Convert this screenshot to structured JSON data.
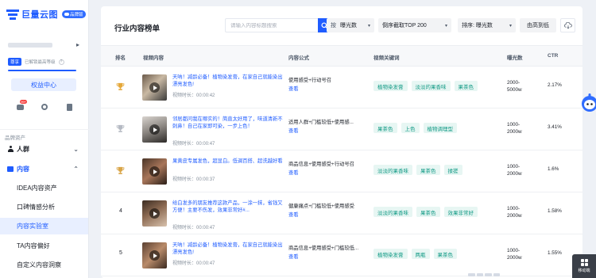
{
  "brand": {
    "logo_text": "巨量云图",
    "badge_text": "品牌版"
  },
  "account": {
    "vip_tag": "尊享",
    "vip_text": "已解锁最高等级",
    "rights_button": "权益中心",
    "chat_badge": "99+"
  },
  "sidebar": {
    "section_label": "品牌资产",
    "people_label": "人群",
    "content_label": "内容",
    "content_items": [
      "IDEA内容资产",
      "口碑情感分析",
      "内容实验室",
      "TA内容偏好",
      "自定义内容洞察"
    ],
    "active_item": "内容实验室"
  },
  "toolbar": {
    "title": "行业内容榜单",
    "search_placeholder": "请输入内容标题搜索",
    "metric_lead": "按",
    "metric_value": "曝光数",
    "cutoff_value": "倒序截取TOP 200",
    "sort_value": "排序: 曝光数",
    "order_value": "由高到低"
  },
  "table": {
    "headers": [
      "排名",
      "视频内容",
      "内容公式",
      "视频关键词",
      "曝光数",
      "CTR"
    ],
    "view_link_label": "查看",
    "duration_prefix": "视频时长：",
    "rows": [
      {
        "rank": "1",
        "title": "天呐！减龄必备！植物染发膏，在家自己就能染出漂亮发色!",
        "duration": "00:00:42",
        "formula": "使用感受+行动号召",
        "keywords": [
          "植物染发膏",
          "淡淡的果香味",
          "果茶色"
        ],
        "exposure_l1": "2000-",
        "exposure_l2": "5000w",
        "ctr": "2.17%"
      },
      {
        "rank": "2",
        "title": "邻居都问我在哪实的！简直太好用了，味道清新不刺鼻！自己在家即可染，一步上色！",
        "duration": "00:00:47",
        "formula": "适用人群+门槛较低+使用感...",
        "keywords": [
          "果茶色",
          "上色",
          "植物调理型"
        ],
        "exposure_l1": "1000-",
        "exposure_l2": "2000w",
        "ctr": "3.41%"
      },
      {
        "rank": "3",
        "title": "果黄皮专属发色，超显白。低调百搭、超洗越好看",
        "duration": "00:00:37",
        "formula": "商品信息+使用感受+行动号召",
        "keywords": [
          "淡淡的果香味",
          "果茶色",
          "揉搓"
        ],
        "exposure_l1": "1000-",
        "exposure_l2": "2000w",
        "ctr": "1.6%"
      },
      {
        "rank": "4",
        "title": "给白发多的朋友推荐这款产品，一涂一抹，省钱又方便！主要不伤发，效果非常好#...",
        "duration": "00:00:47",
        "formula": "健康痛点+门槛较低+使用感受",
        "keywords": [
          "淡淡的果香味",
          "果茶色",
          "效果非常好"
        ],
        "exposure_l1": "1000-",
        "exposure_l2": "2000w",
        "ctr": "1.58%"
      },
      {
        "rank": "5",
        "title": "天呐！减龄必备！植物染发膏，在家自己就能染出漂亮发色!",
        "duration": "00:00:47",
        "formula": "商品信息+使用感受+门槛较低...",
        "keywords": [
          "植物染发膏",
          "两瓶",
          "果茶色"
        ],
        "exposure_l1": "1000-",
        "exposure_l2": "2000w",
        "ctr": "1.55%"
      }
    ]
  },
  "floating": {
    "mobile_label": "移动端"
  },
  "colors": {
    "accent": "#1f5cff",
    "keyword_bg": "#e7f6f3",
    "keyword_text": "#119a85",
    "gold": "#e5a83a",
    "silver": "#b5bac3"
  },
  "icons": [
    "search-icon",
    "download-icon",
    "trophy-gold-icon",
    "trophy-silver-icon",
    "play-icon",
    "gear-icon",
    "chat-icon",
    "document-icon",
    "person-icon",
    "folder-icon",
    "grid-icon"
  ]
}
